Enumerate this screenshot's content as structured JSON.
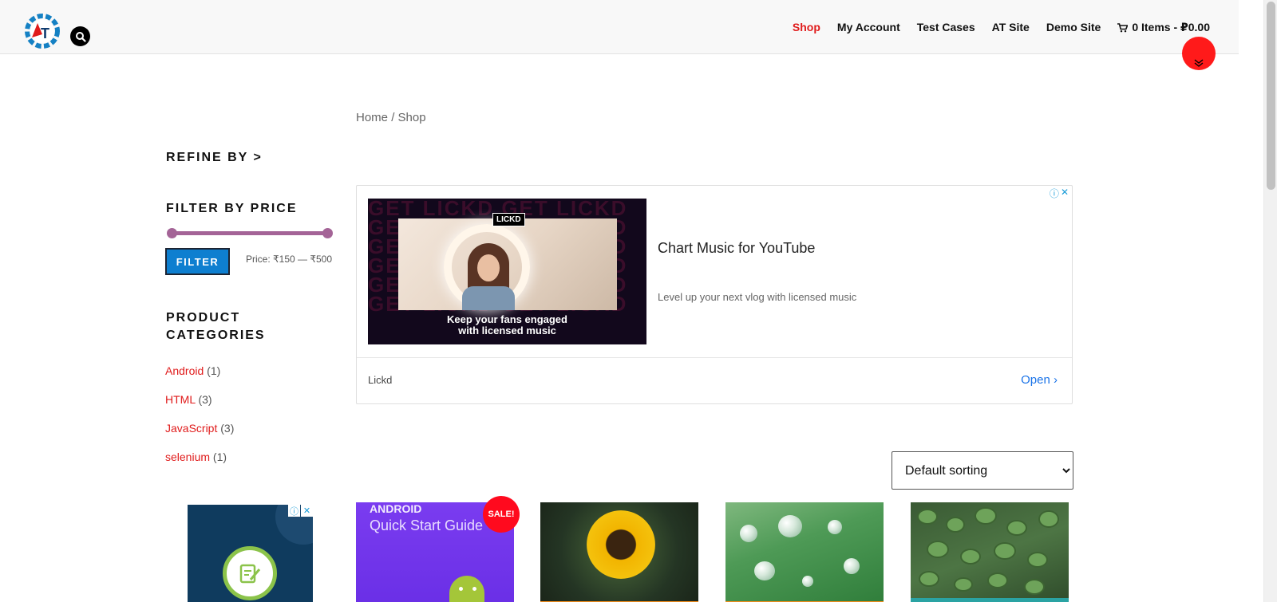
{
  "header": {
    "logo_text": "AT",
    "nav": [
      {
        "label": "Shop",
        "active": true
      },
      {
        "label": "My Account",
        "active": false
      },
      {
        "label": "Test Cases",
        "active": false
      },
      {
        "label": "AT Site",
        "active": false
      },
      {
        "label": "Demo Site",
        "active": false
      }
    ],
    "cart_label": "0 Items - ₽0.00"
  },
  "breadcrumb": {
    "home": "Home",
    "separator": "/",
    "current": "Shop"
  },
  "sidebar": {
    "refine_heading": "REFINE BY >",
    "filter_heading": "FILTER BY PRICE",
    "filter_button": "FILTER",
    "price_label": "Price: ₹150 — ₹500",
    "categories_heading_line1": "PRODUCT",
    "categories_heading_line2": "CATEGORIES",
    "categories": [
      {
        "name": "Android",
        "count": "(1)"
      },
      {
        "name": "HTML",
        "count": "(3)"
      },
      {
        "name": "JavaScript",
        "count": "(3)"
      },
      {
        "name": "selenium",
        "count": "(1)"
      }
    ]
  },
  "ad": {
    "brand": "LICKD",
    "pattern_text": "GET LICKD GET LICKD",
    "image_caption_line1": "Keep your fans engaged",
    "image_caption_line2": "with licensed music",
    "title": "Chart Music for YouTube",
    "description": "Level up your next vlog with licensed music",
    "advertiser": "Lickd",
    "cta": "Open"
  },
  "sorting": {
    "selected": "Default sorting",
    "options": [
      "Default sorting"
    ]
  },
  "products": {
    "sale_badge": "SALE!",
    "android_title_line1": "ANDROID",
    "android_title_line2": "Quick Start Guide"
  },
  "colors": {
    "accent_red": "#e01b1b",
    "button_blue": "#0e7fd0",
    "slider_purple": "#a46497",
    "sale_red": "#ff0a1e"
  }
}
